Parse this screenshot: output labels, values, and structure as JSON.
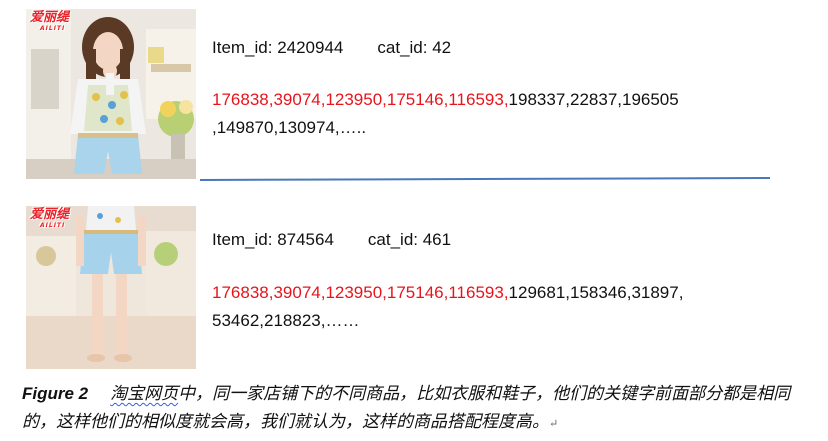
{
  "products": [
    {
      "brand": "爱丽缇",
      "brand_sub": "AILITI",
      "item_id_label": "Item_id: 2420944",
      "cat_id_label": "cat_id: 42",
      "keywords_red_line1": "176838,39074,123950,175146,116593,",
      "keywords_black_line1": "198337,22837,196505",
      "keywords_line2": ",149870,130974,…..",
      "image_icon": "woman-in-top-and-shorts-photo"
    },
    {
      "brand": "爱丽缇",
      "brand_sub": "AILITI",
      "item_id_label": "Item_id: 874564",
      "cat_id_label": "cat_id: 461",
      "keywords_red_line1": "176838,39074,123950,175146,116593,",
      "keywords_black_line1": "129681,158346,31897,",
      "keywords_line2": "53462,218823,……",
      "image_icon": "woman-in-shorts-full-body-photo"
    }
  ],
  "divider_color": "#4a78b8",
  "keyword_highlight_color": "#e8141c",
  "caption": {
    "figure_label": "Figure 2",
    "underlined_text": "淘宝网页",
    "text": "中，同一家店铺下的不同商品，比如衣服和鞋子，他们的关键字前面部分都是相同的，这样他们的相似度就会高，我们就认为，这样的商品搭配程度高。",
    "end_mark": "↵"
  }
}
